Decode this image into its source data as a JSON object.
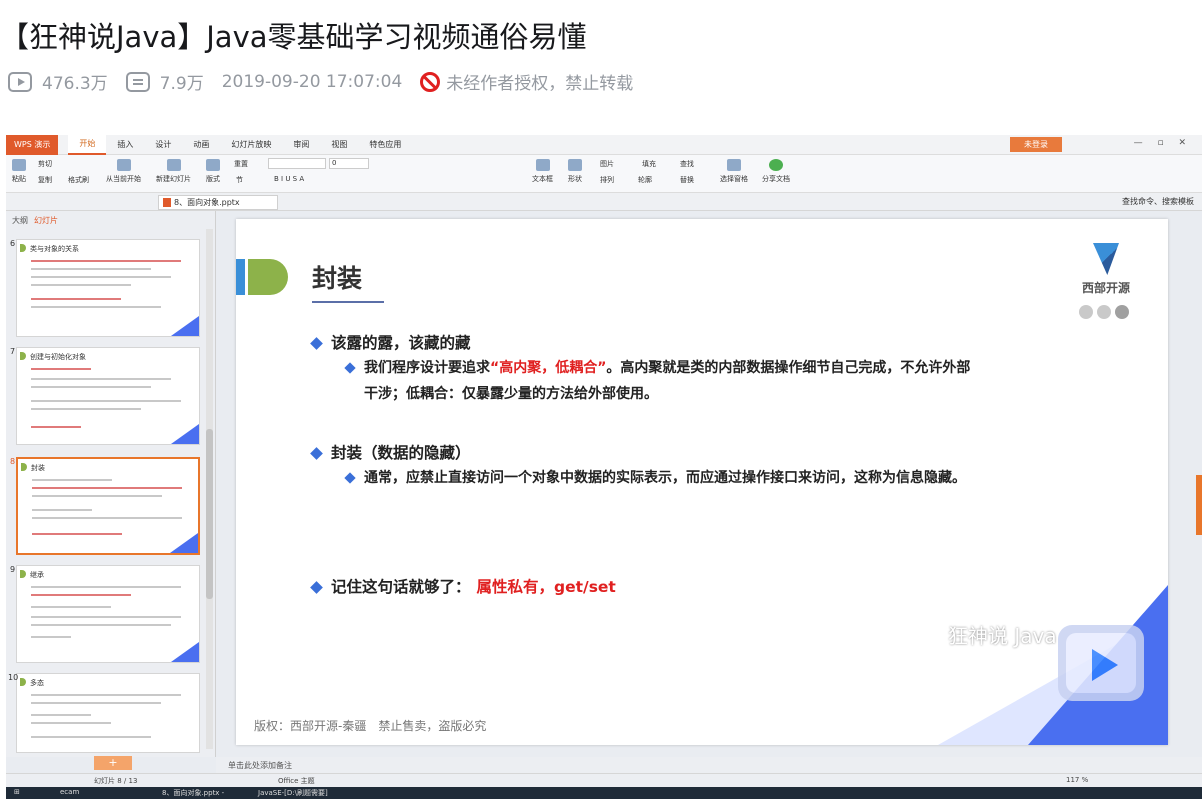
{
  "video": {
    "title": "【狂神说Java】Java零基础学习视频通俗易懂",
    "views": "476.3万",
    "danmaku": "7.9万",
    "datetime": "2019-09-20 17:07:04",
    "notice": "未经作者授权，禁止转载"
  },
  "wps": {
    "app_button": "WPS 演示",
    "menu_tabs": [
      "开始",
      "插入",
      "设计",
      "动画",
      "幻灯片放映",
      "审阅",
      "视图",
      "特色应用"
    ],
    "login": "未登录",
    "ribbon": {
      "paste": "粘贴",
      "cut": "剪切",
      "copy": "复制",
      "format_painter": "格式刷",
      "from_start": "从当前开始",
      "new_slide": "新建幻灯片",
      "layout": "版式",
      "reset": "重置",
      "section": "节",
      "font_size": "0",
      "textbox": "文本框",
      "shape": "形状",
      "picture": "图片",
      "arrange": "排列",
      "outline": "轮廓",
      "fill": "填充",
      "find": "查找",
      "replace": "替换",
      "select_pane": "选择窗格",
      "share": "分享文档"
    },
    "doc_tab": "8、面向对象.pptx",
    "search_cmd": "查找命令、搜索模板",
    "panel_tabs": {
      "outline": "大纲",
      "slides": "幻灯片"
    },
    "thumbnails": [
      {
        "num": "6",
        "title": "类与对象的关系"
      },
      {
        "num": "7",
        "title": "创建与初始化对象"
      },
      {
        "num": "8",
        "title": "封装"
      },
      {
        "num": "9",
        "title": "继承"
      },
      {
        "num": "10",
        "title": "多态"
      }
    ],
    "notes_placeholder": "单击此处添加备注",
    "status": {
      "slide_count": "幻灯片 8 / 13",
      "theme": "Office 主题",
      "zoom": "117 %"
    },
    "taskbar": {
      "item1": "ecam",
      "item2": "8、面向对象.pptx -",
      "item3": "JavaSE-[D:\\刷题需要]"
    }
  },
  "slide": {
    "title": "封装",
    "logo_text": "西部开源",
    "bullet1": "该露的露，该藏的藏",
    "bullet1_sub_a": "我们程序设计要追求",
    "bullet1_sub_red": "“高内聚，低耦合”",
    "bullet1_sub_b": "。高内聚就是类的内部数据操作细节自己完成，不允许外部",
    "bullet1_sub_c": "干涉；低耦合：仅暴露少量的方法给外部使用。",
    "bullet2": "封装（数据的隐藏）",
    "bullet2_sub": "通常，应禁止直接访问一个对象中数据的实际表示，而应通过操作接口来访问，这称为信息隐藏。",
    "bullet3": "记住这句话就够了：",
    "bullet3_red": "属性私有，get/set",
    "footer": "版权：西部开源-秦疆　禁止售卖，盗版必究"
  },
  "overlay": {
    "watermark": "狂神说 Java"
  },
  "colors": {
    "accent_orange": "#e05a2b",
    "slide_green": "#8db24a",
    "slide_blue": "#3a8fd8",
    "bullet_blue": "#3a6fd8",
    "red_text": "#e02020"
  }
}
